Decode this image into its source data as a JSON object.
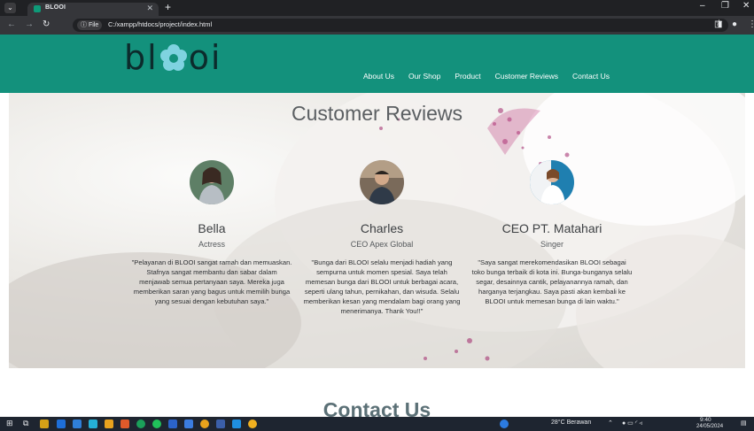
{
  "browser": {
    "tab_title": "BLOOI",
    "url_chip": "ⓘ File",
    "url": "C:/xampp/htdocs/project/index.html"
  },
  "site": {
    "logo_left": "bl",
    "logo_right": "oi",
    "nav": [
      "About Us",
      "Our Shop",
      "Product",
      "Customer Reviews",
      "Contact Us"
    ],
    "section_title": "Customer Reviews",
    "reviews": [
      {
        "name": "Bella",
        "role": "Actress",
        "text": "\"Pelayanan di BLOOI sangat ramah dan memuaskan. Stafnya sangat membantu dan sabar dalam menjawab semua pertanyaan saya. Mereka juga memberikan saran yang bagus untuk memilih bunga yang sesuai dengan kebutuhan saya.\""
      },
      {
        "name": "Charles",
        "role": "CEO Apex Global",
        "text": "\"Bunga dari BLOOI selalu menjadi hadiah yang sempurna untuk momen spesial. Saya telah memesan bunga dari BLOOI untuk berbagai acara, seperti ulang tahun, pernikahan, dan wisuda. Selalu memberikan kesan yang mendalam bagi orang yang menerimanya. Thank You!!\""
      },
      {
        "name": "CEO PT. Matahari",
        "role": "Singer",
        "text": "\"Saya sangat merekomendasikan BLOOI sebagai toko bunga terbaik di kota ini. Bunga-bunganya selalu segar, desainnya cantik, pelayanannya ramah, dan harganya terjangkau. Saya pasti akan kembali ke BLOOI untuk memesan bunga di lain waktu.\""
      }
    ],
    "next_section_title": "Contact Us"
  },
  "taskbar": {
    "weather": "28°C Berawan",
    "time": "9:40",
    "date": "24/05/2024"
  },
  "colors": {
    "brand_teal": "#13917c",
    "logo_dark": "#0c2b2c",
    "taskbar": "#1e2530"
  }
}
